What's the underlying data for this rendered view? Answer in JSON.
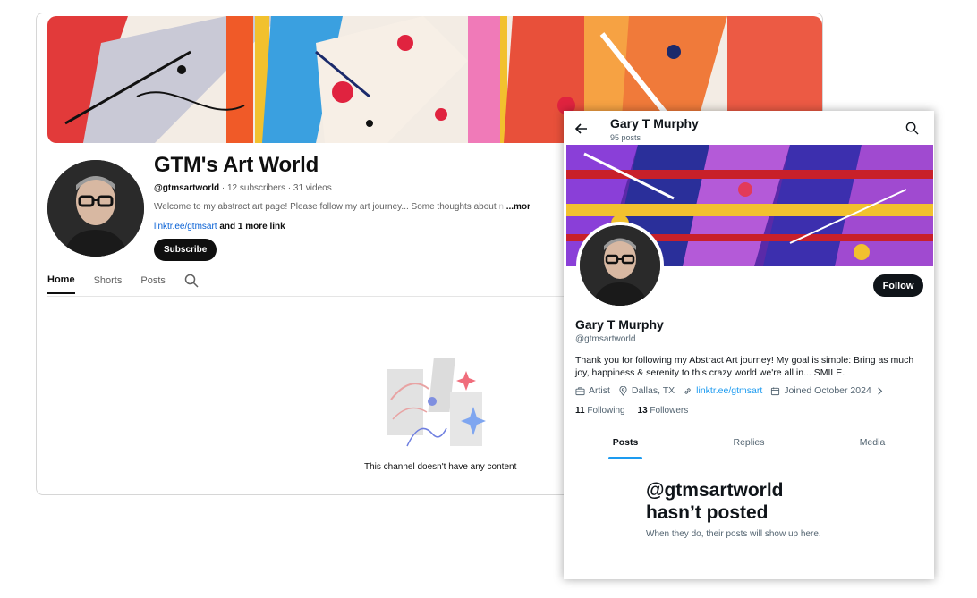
{
  "youtube": {
    "channel_name": "GTM's Art World",
    "handle": "@gtmsartworld",
    "stats": " · 12 subscribers · 31 videos",
    "description": "Welcome to my abstract art page! Please follow my art journey... Some thoughts about ",
    "description_fade": "n",
    "more_label": " ...more",
    "link": "linktr.ee/gtmsart",
    "link_extra": " and 1 more link",
    "subscribe_label": "Subscribe",
    "tabs": [
      {
        "label": "Home",
        "active": true
      },
      {
        "label": "Shorts",
        "active": false
      },
      {
        "label": "Posts",
        "active": false
      }
    ],
    "empty_message": "This channel doesn't have any content"
  },
  "twitter": {
    "header_name": "Gary T Murphy",
    "post_count": "95 posts",
    "follow_label": "Follow",
    "display_name": "Gary T Murphy",
    "handle": "@gtmsartworld",
    "bio": "Thank you for following my Abstract Art journey! My goal is simple: Bring as much joy, happiness & serenity to this crazy world we're all in... SMILE.",
    "profession": "Artist",
    "location": "Dallas, TX",
    "website": "linktr.ee/gtmsart",
    "joined": "Joined October 2024",
    "following_count": "11",
    "following_label": " Following",
    "followers_count": "13",
    "followers_label": " Followers",
    "tabs": [
      {
        "label": "Posts",
        "active": true
      },
      {
        "label": "Replies",
        "active": false
      },
      {
        "label": "Media",
        "active": false
      }
    ],
    "empty_title_line1": "@gtmsartworld",
    "empty_title_line2": "hasn’t posted",
    "empty_subtitle": "When they do, their posts will show up here."
  },
  "colors": {
    "youtube_link": "#065fd4",
    "twitter_link": "#1d9bf0",
    "twitter_tab_indicator": "#1d9bf0",
    "button_dark": "#0f0f0f"
  }
}
